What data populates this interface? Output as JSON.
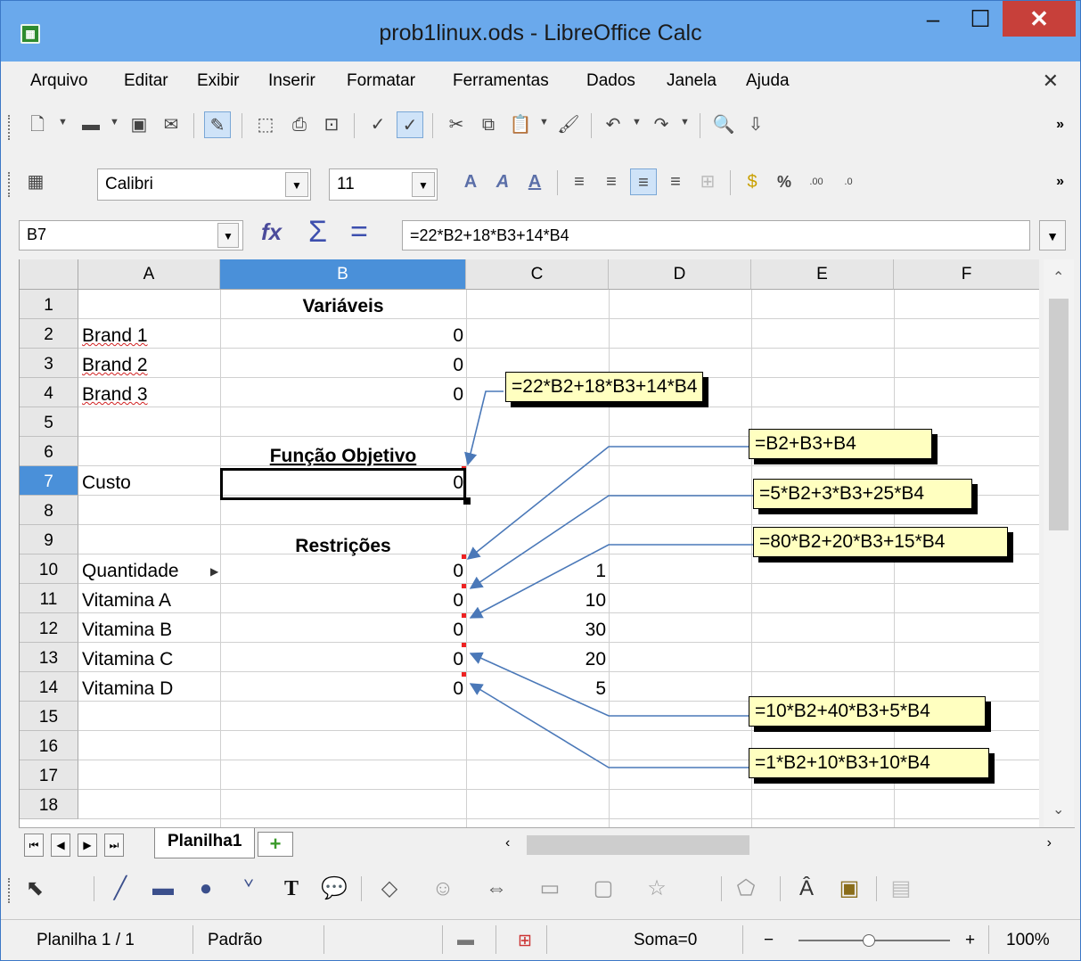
{
  "window": {
    "title": "prob1linux.ods - LibreOffice Calc"
  },
  "menu": [
    "Arquivo",
    "Editar",
    "Exibir",
    "Inserir",
    "Formatar",
    "Ferramentas",
    "Dados",
    "Janela",
    "Ajuda"
  ],
  "formatting": {
    "font_name": "Calibri",
    "font_size": "11"
  },
  "formula_bar": {
    "cell_ref": "B7",
    "formula": "=22*B2+18*B3+14*B4"
  },
  "columns": [
    "A",
    "B",
    "C",
    "D",
    "E",
    "F"
  ],
  "selected_column": "B",
  "rows": [
    "1",
    "2",
    "3",
    "4",
    "5",
    "6",
    "7",
    "8",
    "9",
    "10",
    "11",
    "12",
    "13",
    "14",
    "15",
    "16",
    "17",
    "18"
  ],
  "selected_row": "7",
  "cells": {
    "B1": "Variáveis",
    "A2": "Brand 1",
    "B2": "0",
    "A3": "Brand 2",
    "B3": "0",
    "A4": "Brand 3",
    "B4": "0",
    "B6": "Função Objetivo",
    "A7": "Custo",
    "B7": "0",
    "B9": "Restrições",
    "A10": "Quantidade",
    "B10": "0",
    "C10": "1",
    "A11": "Vitamina A",
    "B11": "0",
    "C11": "10",
    "A12": "Vitamina B",
    "B12": "0",
    "C12": "30",
    "A13": "Vitamina C",
    "B13": "0",
    "C13": "20",
    "A14": "Vitamina D",
    "B14": "0",
    "C14": "5"
  },
  "callouts": {
    "objective": "=22*B2+18*B3+14*B4",
    "quantidade": "=B2+B3+B4",
    "vitamina_a": "=5*B2+3*B3+25*B4",
    "vitamina_b": "=80*B2+20*B3+15*B4",
    "vitamina_c": "=10*B2+40*B3+5*B4",
    "vitamina_d": "=1*B2+10*B3+10*B4"
  },
  "sheet_tabs": {
    "active": "Planilha1"
  },
  "status": {
    "sheet": "Planilha 1 / 1",
    "style": "Padrão",
    "sum": "Soma=0",
    "zoom": "100%"
  },
  "colors": {
    "titlebar": "#6aa9ec",
    "selection": "#4a90d9",
    "callout_bg": "#ffffc0",
    "arrow": "#4a78b8",
    "close": "#c7403a"
  }
}
